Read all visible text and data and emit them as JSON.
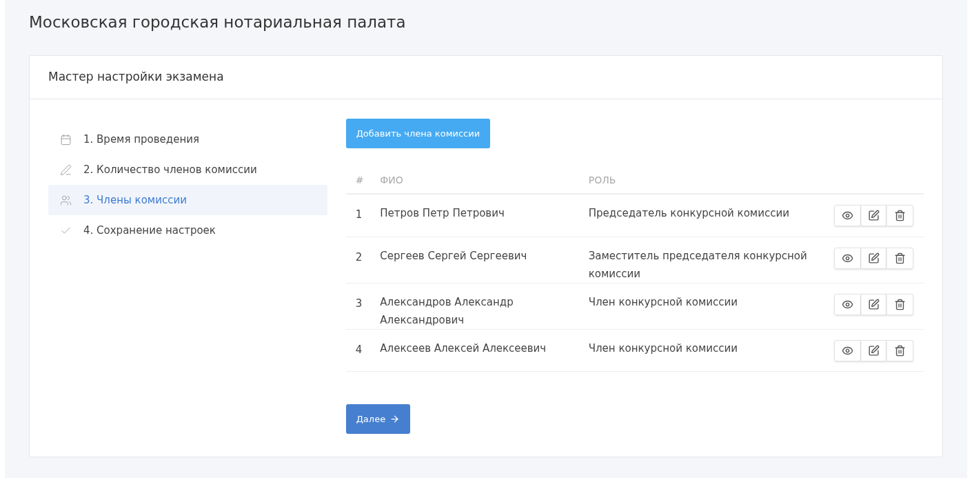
{
  "page": {
    "title": "Московская городская нотариальная палата"
  },
  "card": {
    "title": "Мастер настройки экзамена"
  },
  "steps": [
    {
      "kind": "calendar",
      "label": "1. Время проведения",
      "selected": false
    },
    {
      "kind": "pencil",
      "label": "2. Количество членов комиссии",
      "selected": false
    },
    {
      "kind": "users",
      "label": "3. Члены комиссии",
      "selected": true
    },
    {
      "kind": "check",
      "label": "4. Сохранение настроек",
      "selected": false
    }
  ],
  "add_button": "Добавить члена комиссии",
  "table": {
    "columns": [
      "#",
      "ФИО",
      "РОЛЬ"
    ],
    "rows": [
      {
        "num": "1",
        "name": "Петров Петр Петрович",
        "role": "Председатель конкурсной комиссии"
      },
      {
        "num": "2",
        "name": "Сергеев Сергей Сергеевич",
        "role": "Заместитель председателя конкурсной комиссии"
      },
      {
        "num": "3",
        "name": "Александров Александр Александрович",
        "role": "Член конкурсной комиссии"
      },
      {
        "num": "4",
        "name": "Алексеев Алексей Алексеевич",
        "role": "Член конкурсной комиссии"
      }
    ]
  },
  "next_button": "Далее"
}
